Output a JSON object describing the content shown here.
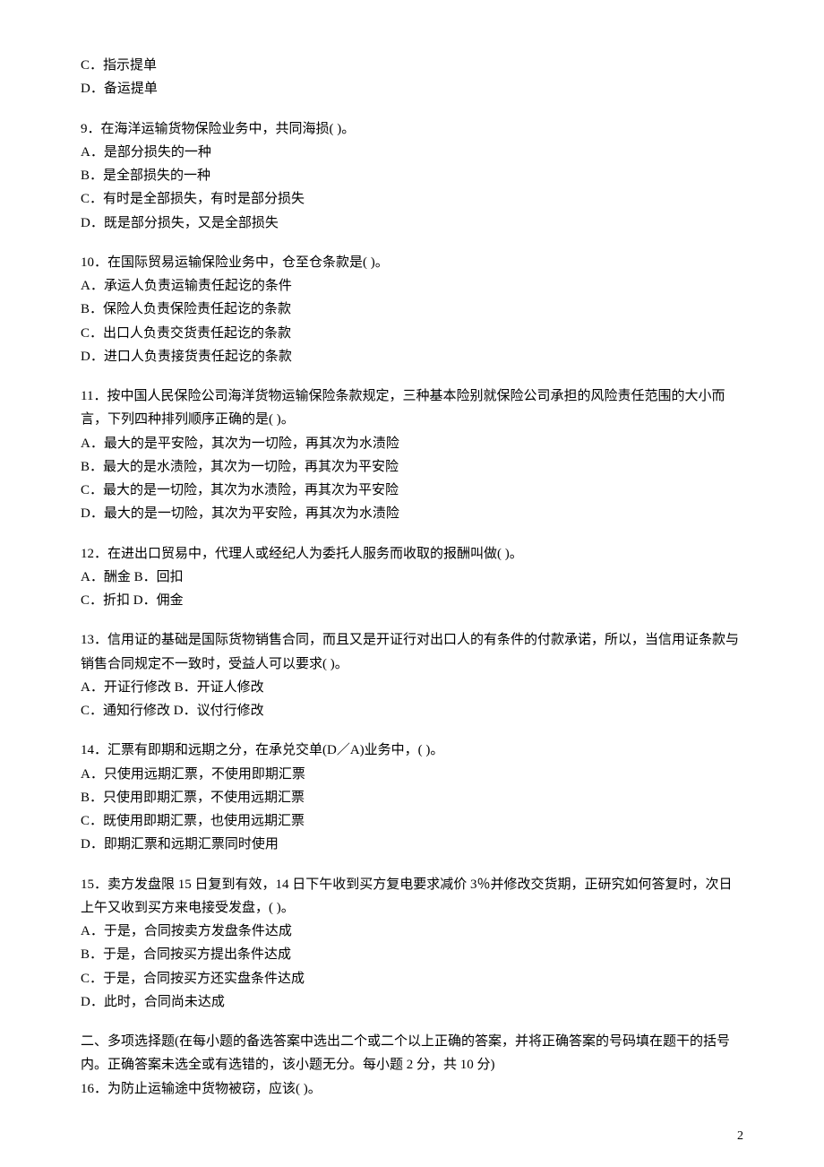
{
  "page_number": "2",
  "leading_options": [
    "C．指示提单",
    "D．备运提单"
  ],
  "questions": [
    {
      "stem": "9．在海洋运输货物保险业务中，共同海损( )。",
      "options": [
        "A．是部分损失的一种",
        "B．是全部损失的一种",
        "C．有时是全部损失，有时是部分损失",
        "D．既是部分损失，又是全部损失"
      ]
    },
    {
      "stem": "10．在国际贸易运输保险业务中，仓至仓条款是( )。",
      "options": [
        "A．承运人负责运输责任起讫的条件",
        "B．保险人负责保险责任起讫的条款",
        "C．出口人负责交货责任起讫的条款",
        "D．进口人负责接货责任起讫的条款"
      ]
    },
    {
      "stem": "11．按中国人民保险公司海洋货物运输保险条款规定，三种基本险别就保险公司承担的风险责任范围的大小而言，下列四种排列顺序正确的是( )。",
      "options": [
        "A．最大的是平安险，其次为一切险，再其次为水渍险",
        "B．最大的是水渍险，其次为一切险，再其次为平安险",
        "C．最大的是一切险，其次为水渍险，再其次为平安险",
        "D．最大的是一切险，其次为平安险，再其次为水渍险"
      ]
    },
    {
      "stem": "12．在进出口贸易中，代理人或经纪人为委托人服务而收取的报酬叫做( )。",
      "options": [
        "A．酬金 B．回扣",
        "C．折扣 D．佣金"
      ]
    },
    {
      "stem": "13．信用证的基础是国际货物销售合同，而且又是开证行对出口人的有条件的付款承诺，所以，当信用证条款与销售合同规定不一致时，受益人可以要求( )。",
      "options": [
        "A．开证行修改 B．开证人修改",
        "C．通知行修改 D．议付行修改"
      ]
    },
    {
      "stem": "14．汇票有即期和远期之分，在承兑交单(D／A)业务中，( )。",
      "options": [
        "A．只使用远期汇票，不使用即期汇票",
        "B．只使用即期汇票，不使用远期汇票",
        "C．既使用即期汇票，也使用远期汇票",
        "D．即期汇票和远期汇票同时使用"
      ]
    },
    {
      "stem": "15．卖方发盘限 15 日复到有效，14 日下午收到买方复电要求减价 3％并修改交货期，正研究如何答复时，次日上午又收到买方来电接受发盘，( )。",
      "options": [
        "A．于是，合同按卖方发盘条件达成",
        "B．于是，合同按买方提出条件达成",
        "C．于是，合同按买方还实盘条件达成",
        "D．此时，合同尚未达成"
      ]
    }
  ],
  "section2": {
    "heading": "二、多项选择题(在每小题的备选答案中选出二个或二个以上正确的答案，并将正确答案的号码填在题干的括号内。正确答案未选全或有选错的，该小题无分。每小题 2 分，共 10 分)",
    "q16": "16．为防止运输途中货物被窃，应该( )。"
  }
}
